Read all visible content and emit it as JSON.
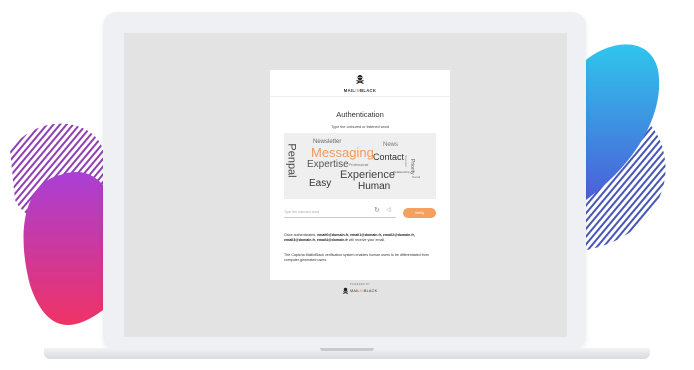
{
  "colors": {
    "accent": "#f5a05e",
    "brand_orange": "#f28a4f",
    "blob_pink": "#e8336b",
    "blob_blue": "#2cc3ea"
  },
  "brand": {
    "logo_mail": "MAIL",
    "logo_in": "IN",
    "logo_black": "BLACK",
    "logo_icon": "skull-crossbones-icon"
  },
  "auth": {
    "title": "Authentication",
    "instruction": "Type the coloured or listened word",
    "captcha_words": [
      "Newsletter",
      "News",
      "Messaging",
      "Contact",
      "Penpal",
      "Expertise",
      "Professional",
      "Priority",
      "Important",
      "Relationship",
      "Social",
      "Experience",
      "Easy",
      "Human"
    ],
    "input_placeholder": "Type the coloured word",
    "verify_label": "Verify",
    "info_prefix": "Once authenticated, ",
    "info_emails": "email0@domain.fr, email1@domain.fr, email2@domain.fr, email3@domain.fr, email4@domain.fr",
    "info_suffix": " will receive your email.",
    "description": "The Captcha MailInBlack verification system enables human users to be differentiated from computer-generated users."
  },
  "footer": {
    "powered_by": "POWERED BY"
  }
}
